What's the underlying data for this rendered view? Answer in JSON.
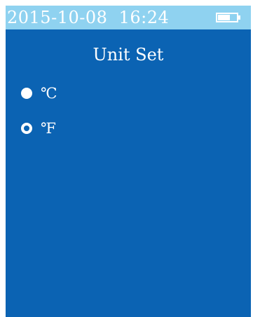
{
  "status_bar": {
    "datetime": "2015-10-08  16:24",
    "battery_icon": "battery-icon",
    "color": "#8fd2f0"
  },
  "screen": {
    "title": "Unit Set",
    "background_color": "#0b63b3",
    "options": [
      {
        "label": "℃",
        "icon": "radio-filled-icon"
      },
      {
        "label": "℉",
        "icon": "radio-hollow-icon"
      }
    ]
  }
}
